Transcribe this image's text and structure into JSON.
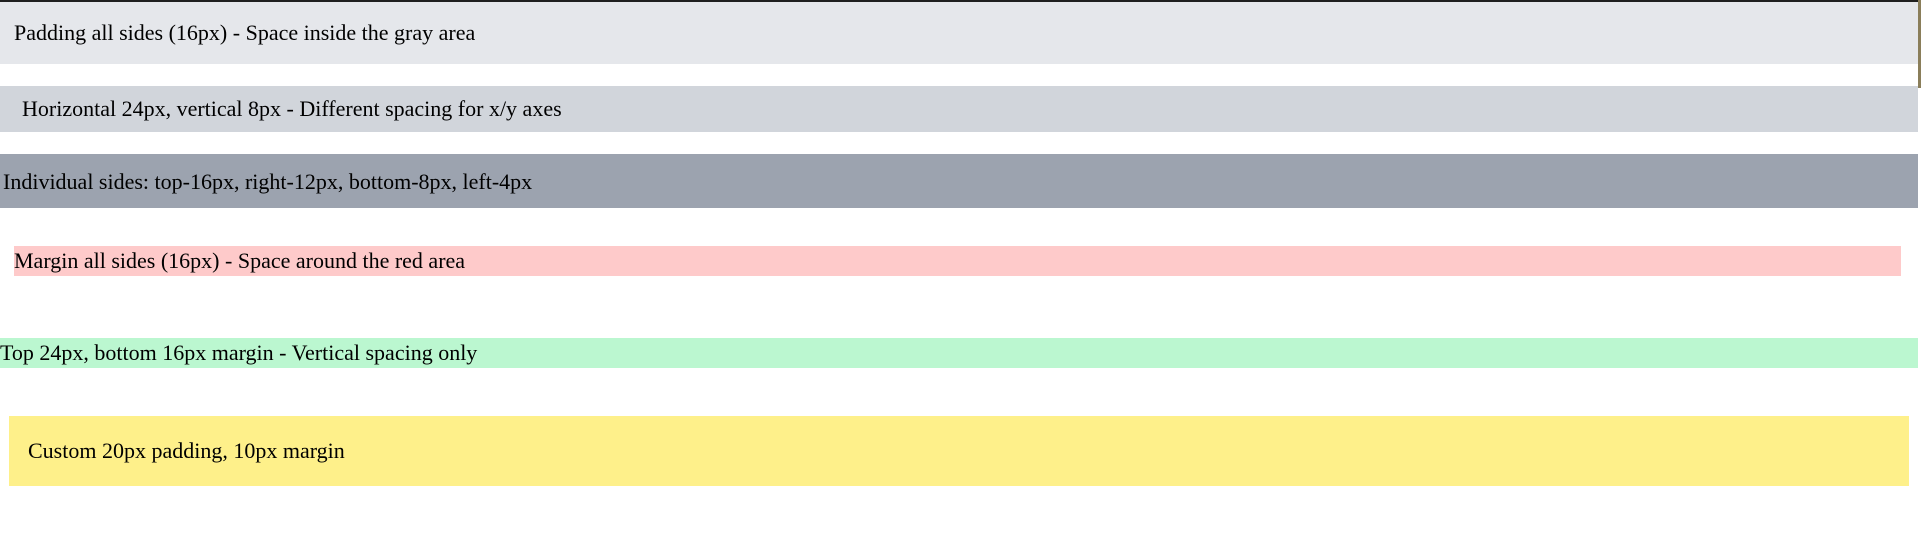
{
  "bands": [
    {
      "text": "Padding all sides (16px) - Space inside the gray area",
      "color": "#e5e7eb"
    },
    {
      "text": "Horizontal 24px, vertical 8px - Different spacing for x/y axes",
      "color": "#d1d5db"
    },
    {
      "text": "Individual sides: top-16px, right-12px, bottom-8px, left-4px",
      "color": "#9ca3af"
    },
    {
      "text": "Margin all sides (16px) - Space around the red area",
      "color": "#fecaca"
    },
    {
      "text": "Top 24px, bottom 16px margin - Vertical spacing only",
      "color": "#bbf7d0"
    },
    {
      "text": "Custom 20px padding, 10px margin",
      "color": "#fef08a"
    }
  ]
}
